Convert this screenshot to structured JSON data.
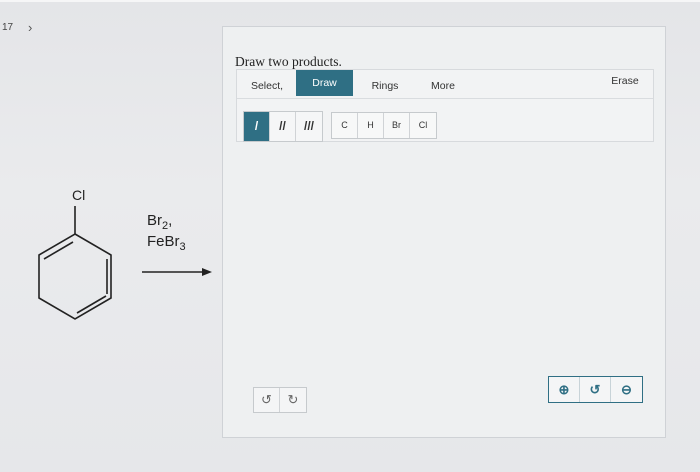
{
  "question": {
    "number": "17",
    "next_icon": "chevron-right-icon"
  },
  "reaction": {
    "substituent": "Cl",
    "reagents": {
      "line1": "Br",
      "line1_sub": "2",
      "line1_suffix": ",",
      "line2": "FeBr",
      "line2_sub": "3"
    }
  },
  "panel": {
    "prompt": "Draw two products.",
    "tabs": {
      "select": "Select,",
      "draw": "Draw",
      "rings": "Rings",
      "more": "More",
      "erase": "Erase"
    },
    "bonds": {
      "single": "/",
      "double": "//",
      "triple": "///"
    },
    "atoms": [
      "C",
      "H",
      "Br",
      "Cl"
    ],
    "undo_icon": "undo-icon",
    "redo_icon": "redo-icon",
    "zoom": {
      "in": "⊕",
      "reset": "↺",
      "out": "⊖"
    }
  },
  "colors": {
    "accent": "#2f6f84"
  }
}
